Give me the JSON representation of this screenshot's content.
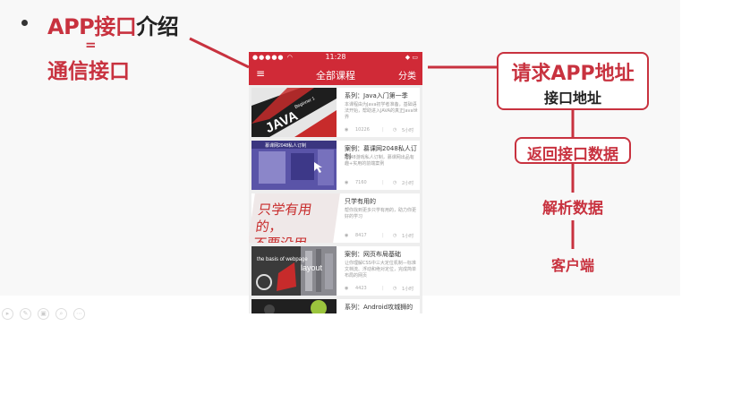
{
  "slide": {
    "title_highlight": "APP接口",
    "title_rest": "介绍",
    "equals": "=",
    "subtitle": "通信接口"
  },
  "phone": {
    "status": {
      "signal": "●●●●● ◠",
      "time": "11:28",
      "battery": "◆ ▭"
    },
    "nav": {
      "menu_icon": "≡",
      "title": "全部课程",
      "category": "分类"
    },
    "cards": [
      {
        "title": "系列：Java入门第一季",
        "desc": "本课程由为Java初学者准备，基础语法开始，帮助进入JAVA的真正Java世界",
        "users": "10226",
        "chapters": "5小时"
      },
      {
        "title": "案例：慕课网2048私人订制",
        "desc": "2048游戏私人订制，慕课网出品有趣+实用的前端案例",
        "users": "7160",
        "chapters": "2小时"
      },
      {
        "title": "只学有用的",
        "desc": "帮你找到更多只学有用的，助力你更好的学习",
        "users": "8417",
        "chapters": "1小时"
      },
      {
        "title": "案例：网页布局基础",
        "desc": "让你理解CSS中三大定位机制—标准文档流、浮动和绝对定位，完成简单布局的网页",
        "users": "4423",
        "chapters": "1小时"
      },
      {
        "title": "系列：Android攻城狮的",
        "desc": "",
        "users": "",
        "chapters": ""
      }
    ],
    "thumbs": {
      "java_text": "JAVA",
      "java_sub": "Beginner 1",
      "game_text": "慕课网2048私人订制",
      "xue_line1": "只学有用的，",
      "xue_line2": "不要没用的！",
      "web_line1": "the basis of webpage",
      "web_line2": "layout"
    }
  },
  "flow": {
    "request": "请求APP地址",
    "request_sub": "接口地址",
    "return": "返回接口数据",
    "parse": "解析数据",
    "client": "客户端"
  },
  "colors": {
    "accent": "#c8323f",
    "phone_bar": "#d02a37"
  },
  "toolbar_icons": [
    "play-icon",
    "pen-icon",
    "screen-icon",
    "zoom-icon",
    "more-icon"
  ]
}
